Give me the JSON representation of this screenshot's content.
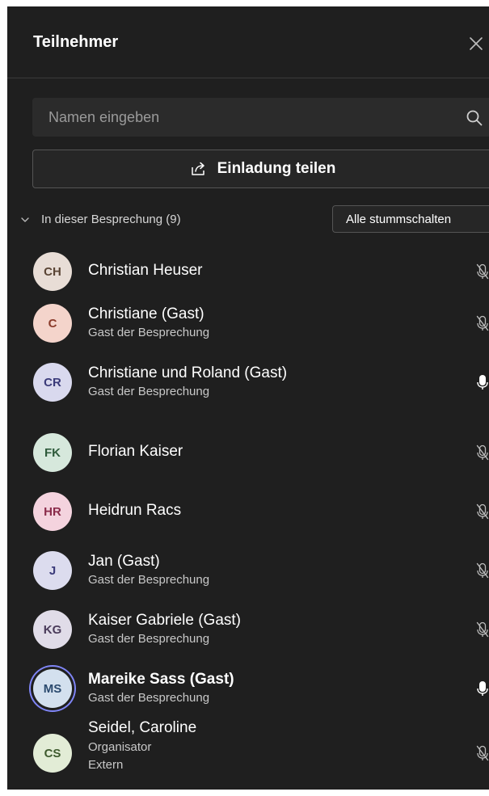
{
  "header": {
    "title": "Teilnehmer"
  },
  "search": {
    "placeholder": "Namen eingeben"
  },
  "invite": {
    "label": "Einladung teilen"
  },
  "section": {
    "label": "In dieser Besprechung (9)",
    "mute_all_label": "Alle stummschalten"
  },
  "colors": {
    "panel": "#1f1f1f",
    "accent_ring": "#7f85f5"
  },
  "participants": [
    {
      "initials": "CH",
      "name": "Christian Heuser",
      "sub": "",
      "sub2": "",
      "avatar_color": "#e8ddd6",
      "initials_color": "#5a4535",
      "mic": "muted",
      "bold": false
    },
    {
      "initials": "C",
      "name": "Christiane (Gast)",
      "sub": "Gast der Besprechung",
      "sub2": "",
      "avatar_color": "#f4d4cb",
      "initials_color": "#8a3b2b",
      "mic": "muted",
      "bold": false
    },
    {
      "initials": "CR",
      "name": "Christiane und Roland (Gast)",
      "sub": "Gast der Besprechung",
      "sub2": "",
      "avatar_color": "#d9d9ee",
      "initials_color": "#3b3b7a",
      "mic": "unmuted",
      "bold": false
    },
    {
      "initials": "FK",
      "name": "Florian Kaiser",
      "sub": "",
      "sub2": "",
      "avatar_color": "#d6e8dc",
      "initials_color": "#2e5a3b",
      "mic": "muted",
      "bold": false
    },
    {
      "initials": "HR",
      "name": "Heidrun Racs",
      "sub": "",
      "sub2": "",
      "avatar_color": "#f4d3de",
      "initials_color": "#8a2b4a",
      "mic": "muted",
      "bold": false
    },
    {
      "initials": "J",
      "name": "Jan (Gast)",
      "sub": "Gast der Besprechung",
      "sub2": "",
      "avatar_color": "#dcdcee",
      "initials_color": "#3b3b7a",
      "mic": "muted",
      "bold": false
    },
    {
      "initials": "KG",
      "name": "Kaiser Gabriele (Gast)",
      "sub": "Gast der Besprechung",
      "sub2": "",
      "avatar_color": "#e0dce8",
      "initials_color": "#4a3b5a",
      "mic": "muted",
      "bold": false
    },
    {
      "initials": "MS",
      "name": "Mareike Sass (Gast)",
      "sub": "Gast der Besprechung",
      "sub2": "",
      "avatar_color": "#d3e0ee",
      "initials_color": "#2b4a6e",
      "mic": "unmuted",
      "bold": true
    },
    {
      "initials": "CS",
      "name": "Seidel, Caroline",
      "sub": "Organisator",
      "sub2": "Extern",
      "avatar_color": "#e2ecd6",
      "initials_color": "#3e5a2e",
      "mic": "muted",
      "bold": false
    }
  ]
}
